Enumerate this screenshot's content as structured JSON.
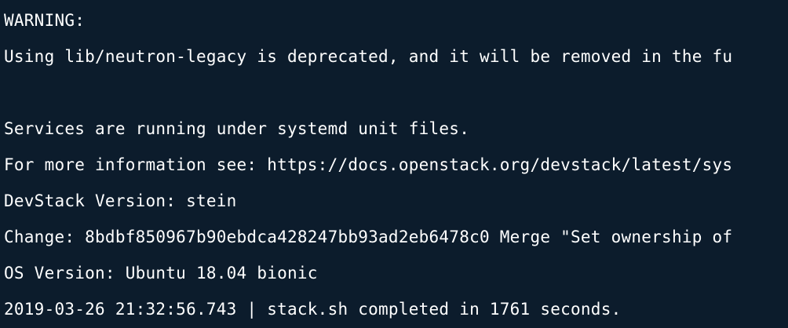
{
  "terminal": {
    "background": "#0c1c2c",
    "foreground": "#ffffff",
    "lines": [
      "WARNING:",
      "Using lib/neutron-legacy is deprecated, and it will be removed in the fu",
      "",
      "Services are running under systemd unit files.",
      "For more information see: https://docs.openstack.org/devstack/latest/sys",
      "DevStack Version: stein",
      "Change: 8bdbf850967b90ebdca428247bb93ad2eb6478c0 Merge \"Set ownership of",
      "OS Version: Ubuntu 18.04 bionic",
      "2019-03-26 21:32:56.743 | stack.sh completed in 1761 seconds."
    ]
  }
}
